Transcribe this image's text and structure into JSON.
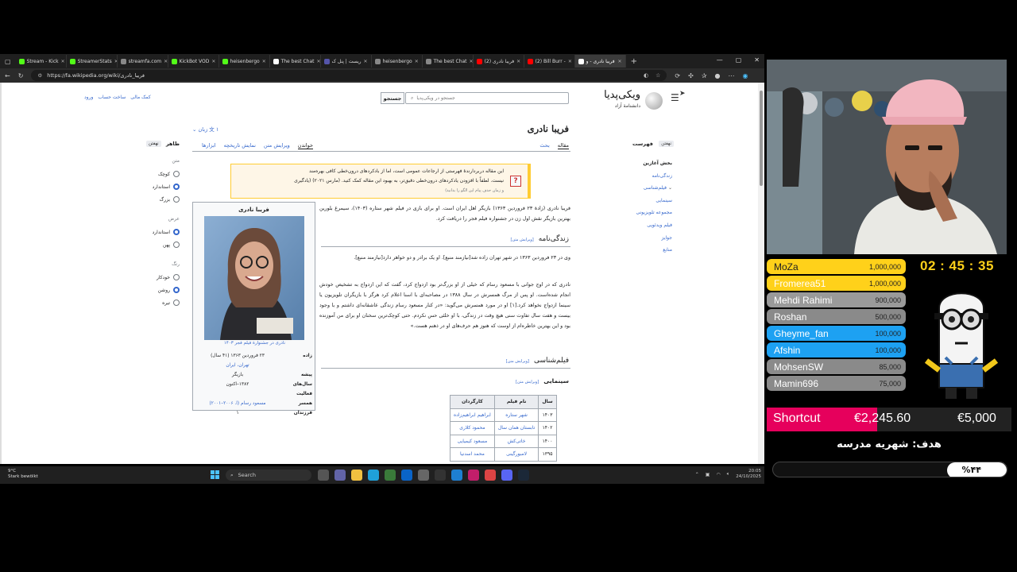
{
  "browser": {
    "tabs": [
      {
        "label": "Stream - Kick",
        "color": "#53fc18"
      },
      {
        "label": "StreamerStats",
        "color": "#53fc18"
      },
      {
        "label": "streamfa.com",
        "color": "#888888"
      },
      {
        "label": "KickBot VOD",
        "color": "#53fc18"
      },
      {
        "label": "heisenbergo",
        "color": "#53fc18"
      },
      {
        "label": "The best Chat",
        "color": "#ffffff"
      },
      {
        "label": "ریست | پنل ک",
        "color": "#5555aa"
      },
      {
        "label": "heisenbergo",
        "color": "#888888"
      },
      {
        "label": "The best Chat",
        "color": "#888888"
      },
      {
        "label": "(2) فریبا نادری",
        "color": "#ff0000"
      },
      {
        "label": "(2) Bill Burr -",
        "color": "#ff0000"
      },
      {
        "label": "فریبا نادری - و",
        "color": "#ffffff",
        "active": true
      }
    ],
    "new_tab": "+",
    "url": "https://fa.wikipedia.org/wiki/فریبا_نادری"
  },
  "wiki": {
    "logo_title": "ویکی‌پدیا",
    "logo_sub": "دانشنامهٔ آزاد",
    "search_placeholder": "جستجو در ویکی‌پدیا",
    "search_button": "جستجو",
    "user_links": [
      "کمک مالی",
      "ساخت حساب",
      "ورود"
    ],
    "toc_title": "فهرست",
    "toc_hide": "نهفتن",
    "toc_items": [
      "بخش آغازین",
      "زندگی‌نامه",
      "فیلم‌شناسی",
      "سینمایی",
      "مجموعه تلویزیونی",
      "فیلم ویدئویی",
      "جوایز",
      "منابع"
    ],
    "article_title": "فریبا نادری",
    "lang_button": "۱ زبان",
    "tabs_right": [
      "مقاله",
      "بحث"
    ],
    "tabs_left": [
      "خواندن",
      "ویرایش متن",
      "نمایش تاریخچه",
      "ابزارها"
    ],
    "appearance": {
      "title": "ظاهر",
      "hide": "نهفتن",
      "text_label": "متن",
      "text_options": [
        "کوچک",
        "استاندارد",
        "بزرگ"
      ],
      "width_label": "عرض",
      "width_options": [
        "استاندارد",
        "پهن"
      ],
      "color_label": "رنگ",
      "color_options": [
        "خودکار",
        "روشن",
        "تیره"
      ]
    },
    "notice": {
      "line1": "این مقاله دربردارندهٔ فهرستی از ارجاعات عمومی است، اما از بادکردهای درون‌خطی کافی بهره‌مند",
      "line2": "نیست. لطفاً با افزودن یادکردهای درون‌خطی دقیق‌تر، به بهبود این مقاله کمک کنید. (مارس ۲۰۲۱) (یادگیری",
      "line3": "و زمان حذف پیام این الگو را بدانید)"
    },
    "infobox": {
      "title": "فریبا نادری",
      "caption": "نادری در جشنوارهٔ فیلم فجر ۱۴۰۳",
      "rows": [
        {
          "k": "زاده",
          "v": "۲۳ فروردین ۱۳۶۳ (۴۱ سال)"
        },
        {
          "k": "",
          "v": "تهران، ایران"
        },
        {
          "k": "پیشه",
          "v": "بازیگر"
        },
        {
          "k": "سال‌های فعالیت",
          "v": "۱۳۸۲–اکنون"
        },
        {
          "k": "همسر",
          "v": "مسعود رسام (ا. ۲۰۰۶–۲۰۰۱)"
        },
        {
          "k": "فرزندان",
          "v": "۱"
        }
      ]
    },
    "intro": "فریبا نادری (زادهٔ ۲۳ فروردین ۱۳۶۳) بازیگر اهل ایران است. او برای بازی در فیلم شهر ستاره (۱۴۰۳)، سیمرغ بلورین بهترین بازیگر نقش اول زن در جشنواره فیلم فجر را دریافت کرد.",
    "bio_heading": "زندگی‌نامه",
    "edit_source": "[ویرایش متن]",
    "bio_p1": "وی در ۲۳ فروردین ۱۳۶۳ در شهر تهران زاده شد[نیازمند منبع]. او یک برادر و دو خواهر دارد[نیازمند منبع].",
    "bio_p2": "نادری که در اوج جوانی با مسعود رسام که خیلی از او بزرگ‌تر بود ازدواج کرد، گفت که این ازدواج به تشخیص خودش انجام شده‌است. او پس از مرگ همسرش در سال ۱۳۸۸ در مصاحبه‌ای با اسنا اعلام کرد هرگز با بازیگران تلویزیون یا سینما ازدواج نخواهد کرد.[۱] او در مورد همسرش می‌گوید: «در کنار مسعود رسام زندگی عاشقانه‌ای داشتم و با وجود بیست و هفت سال تفاوت سنی هیچ وقت در زندگی، با او خلئی حس نکردم. حتی کوچک‌ترین سخنان او برای من آموزنده بود و این بهترین خاطره‌ام از اوست که هنوز هم حرف‌های او در ذهنم هست.»",
    "film_heading": "فیلم‌شناسی",
    "cinema_heading": "سینمایی",
    "table_headers": [
      "سال",
      "نام فیلم",
      "کارگردان"
    ],
    "table_rows": [
      [
        "۱۴۰۳",
        "شهر ستاره",
        "ابراهیم ابراهیم‌زاده"
      ],
      [
        "۱۴۰۲",
        "تابستان همان سال",
        "محمود کلاری"
      ],
      [
        "۱۴۰۰",
        "خاتی‌کش",
        "مسعود کیمیایی"
      ],
      [
        "۱۳۹۵",
        "لامبورگینی",
        "محمد اسدنیا"
      ]
    ]
  },
  "taskbar": {
    "weather_temp": "9°C",
    "weather_text": "Stark bewölkt",
    "search": "Search",
    "time": "20:05",
    "date": "24/10/2025"
  },
  "overlay": {
    "timer": "02 : 45 : 35",
    "donors": [
      {
        "name": "MoZa",
        "amount": "1,000,000",
        "bg": "#ffd11a",
        "fg": "#222222"
      },
      {
        "name": "Fromerea51",
        "amount": "1,000,000",
        "bg": "#ffd11a",
        "fg": "#ffffff"
      },
      {
        "name": "Mehdi Rahimi",
        "amount": "900,000",
        "bg": "#9a9a9a",
        "fg": "#ffffff"
      },
      {
        "name": "Roshan",
        "amount": "500,000",
        "bg": "#8a8a8a",
        "fg": "#ffffff"
      },
      {
        "name": "Gheyme_fan",
        "amount": "100,000",
        "bg": "#1da1f2",
        "fg": "#ffffff"
      },
      {
        "name": "Afshin",
        "amount": "100,000",
        "bg": "#1da1f2",
        "fg": "#ffffff"
      },
      {
        "name": "MohsenSW",
        "amount": "85,000",
        "bg": "#8a8a8a",
        "fg": "#ffffff"
      },
      {
        "name": "Mamin696",
        "amount": "75,000",
        "bg": "#8a8a8a",
        "fg": "#ffffff"
      }
    ],
    "shortcut_label": "Shortcut",
    "shortcut_current": "€2,245.60",
    "shortcut_goal": "€5,000",
    "shortcut_progress": 0.45,
    "school_goal": "هدف: شهریه مدرسه",
    "school_percent": "%۴۴",
    "school_progress": 0.44
  }
}
